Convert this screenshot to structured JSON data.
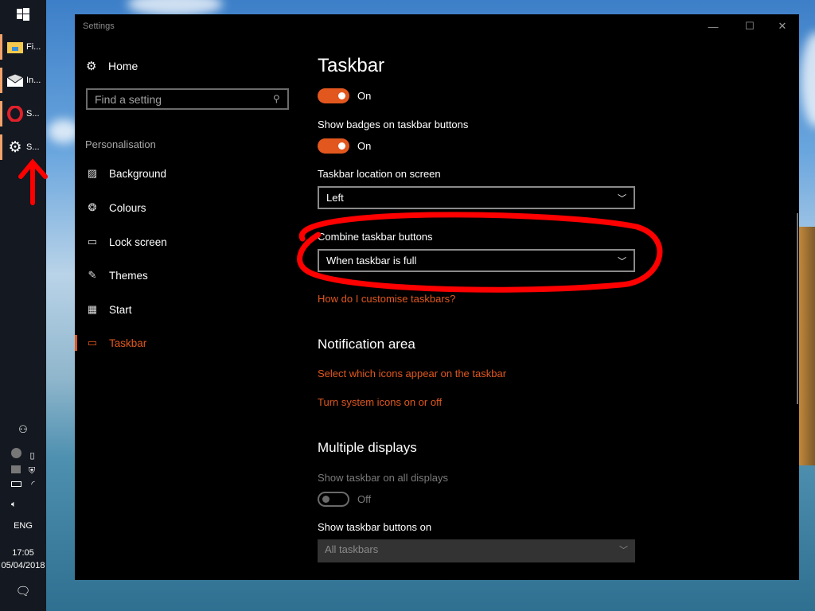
{
  "taskbar": {
    "apps": [
      {
        "label": "Fi...",
        "icon": "file-explorer-icon"
      },
      {
        "label": "In...",
        "icon": "mail-icon"
      },
      {
        "label": "S...",
        "icon": "opera-icon"
      },
      {
        "label": "S...",
        "icon": "settings-gear-icon"
      }
    ],
    "language": "ENG",
    "time": "17:05",
    "date": "05/04/2018"
  },
  "window": {
    "title": "Settings",
    "minimize": "—",
    "maximize": "☐",
    "close": "✕"
  },
  "sidebar": {
    "home": "Home",
    "search_placeholder": "Find a setting",
    "section": "Personalisation",
    "items": [
      {
        "label": "Background",
        "icon": "image-icon"
      },
      {
        "label": "Colours",
        "icon": "palette-icon"
      },
      {
        "label": "Lock screen",
        "icon": "lock-screen-icon"
      },
      {
        "label": "Themes",
        "icon": "themes-icon"
      },
      {
        "label": "Start",
        "icon": "start-icon"
      },
      {
        "label": "Taskbar",
        "icon": "taskbar-icon",
        "active": true
      }
    ]
  },
  "main": {
    "title": "Taskbar",
    "toggle1_state": "On",
    "badges_label": "Show badges on taskbar buttons",
    "badges_state": "On",
    "location_label": "Taskbar location on screen",
    "location_value": "Left",
    "combine_label": "Combine taskbar buttons",
    "combine_value": "When taskbar is full",
    "customise_link": "How do I customise taskbars?",
    "notification_heading": "Notification area",
    "notif_link1": "Select which icons appear on the taskbar",
    "notif_link2": "Turn system icons on or off",
    "multiple_heading": "Multiple displays",
    "all_displays_label": "Show taskbar on all displays",
    "all_displays_state": "Off",
    "buttons_on_label": "Show taskbar buttons on",
    "buttons_on_value": "All taskbars"
  },
  "colors": {
    "accent": "#e2571e",
    "annotation": "#ff0000"
  }
}
